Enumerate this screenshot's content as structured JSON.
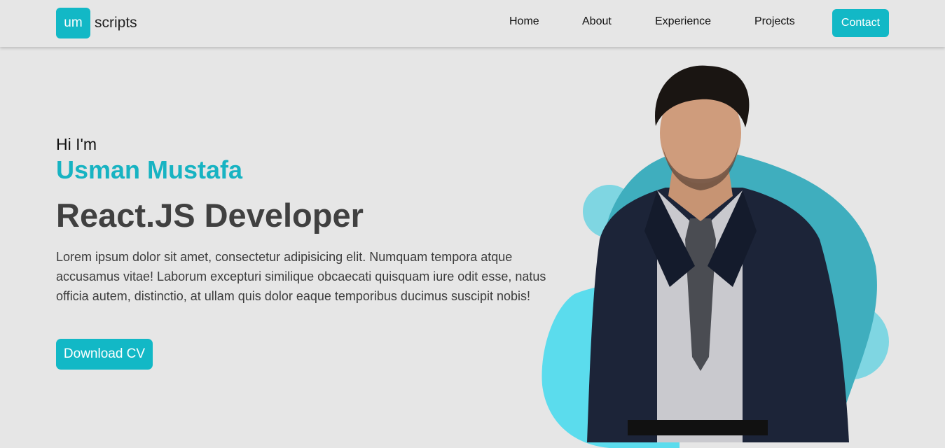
{
  "brand": {
    "badge": "um",
    "text": "scripts"
  },
  "nav": {
    "items": [
      "Home",
      "About",
      "Experience",
      "Projects"
    ],
    "contact_label": "Contact"
  },
  "hero": {
    "greeting": "Hi I'm",
    "name": "Usman Mustafa",
    "role": "React.JS Developer",
    "description": "Lorem ipsum dolor sit amet, consectetur adipisicing elit. Numquam tempora atque accusamus vitae! Laborum excepturi similique obcaecati quisquam iure odit esse, natus officia autem, distinctio, at ullam quis dolor eaque temporibus ducimus suscipit nobis!",
    "cta_label": "Download CV"
  },
  "colors": {
    "accent": "#12b8c6",
    "blob_dark": "#3faebe",
    "blob_light": "#7fd6e2",
    "blob_bright": "#5bdced"
  }
}
